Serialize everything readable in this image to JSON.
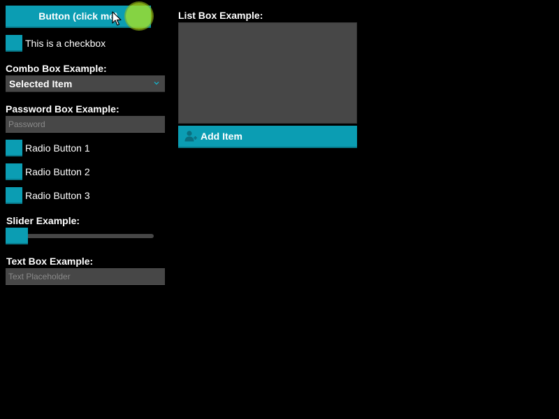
{
  "main_button": {
    "label": "Button (click me)"
  },
  "checkbox": {
    "label": "This is a checkbox",
    "checked": false
  },
  "combo": {
    "title": "Combo Box Example:",
    "selected": "Selected Item"
  },
  "password": {
    "title": "Password Box Example:",
    "placeholder": "Password",
    "value": ""
  },
  "radios": [
    {
      "label": "Radio Button 1",
      "selected": false
    },
    {
      "label": "Radio Button 2",
      "selected": false
    },
    {
      "label": "Radio Button 3",
      "selected": false
    }
  ],
  "slider": {
    "title": "Slider Example:",
    "value": 0
  },
  "textbox": {
    "title": "Text Box Example:",
    "placeholder": "Text Placeholder",
    "value": ""
  },
  "listbox": {
    "title": "List Box Example:",
    "items": []
  },
  "add_button": {
    "label": "Add Item"
  },
  "colors": {
    "accent": "#0b9db3",
    "accent_dark": "#087a8b",
    "field_bg": "#474747",
    "background": "#000000",
    "click_indicator": "#afe61e",
    "chevron": "#15b4cc",
    "add_icon": "#0a6f80"
  },
  "icons": {
    "chevron": "chevron-down-icon",
    "add_user": "add-user-icon",
    "cursor": "mouse-cursor-icon"
  }
}
